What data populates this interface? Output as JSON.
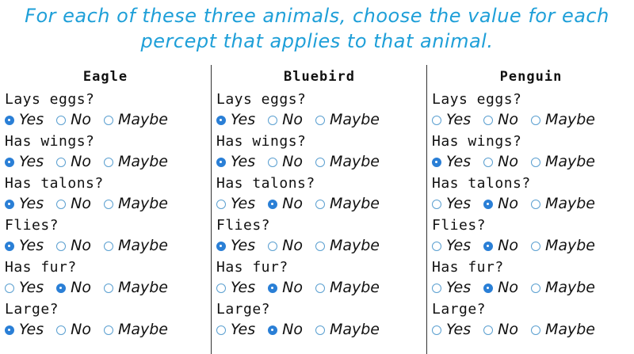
{
  "instructions": {
    "line1": "For each of these three animals, choose the value for each",
    "line2": "percept that applies to that animal."
  },
  "option_labels": [
    "Yes",
    "No",
    "Maybe"
  ],
  "animals": [
    {
      "name": "Eagle",
      "questions": [
        {
          "label": "Lays eggs?",
          "selected": "Yes"
        },
        {
          "label": "Has wings?",
          "selected": "Yes"
        },
        {
          "label": "Has talons?",
          "selected": "Yes"
        },
        {
          "label": "Flies?",
          "selected": "Yes"
        },
        {
          "label": "Has fur?",
          "selected": "No"
        },
        {
          "label": "Large?",
          "selected": "Yes"
        }
      ]
    },
    {
      "name": "Bluebird",
      "questions": [
        {
          "label": "Lays eggs?",
          "selected": "Yes"
        },
        {
          "label": "Has wings?",
          "selected": "Yes"
        },
        {
          "label": "Has talons?",
          "selected": "No"
        },
        {
          "label": "Flies?",
          "selected": "Yes"
        },
        {
          "label": "Has fur?",
          "selected": "No"
        },
        {
          "label": "Large?",
          "selected": "No"
        }
      ]
    },
    {
      "name": "Penguin",
      "questions": [
        {
          "label": "Lays eggs?",
          "selected": ""
        },
        {
          "label": "Has wings?",
          "selected": "Yes"
        },
        {
          "label": "Has talons?",
          "selected": "No"
        },
        {
          "label": "Flies?",
          "selected": "No"
        },
        {
          "label": "Has fur?",
          "selected": "No"
        },
        {
          "label": "Large?",
          "selected": ""
        }
      ]
    }
  ],
  "colors": {
    "instructions_text": "#1e9fd8",
    "radio_selected": "#2a7fd6",
    "radio_border": "#5a9fd0",
    "divider": "#333333"
  }
}
